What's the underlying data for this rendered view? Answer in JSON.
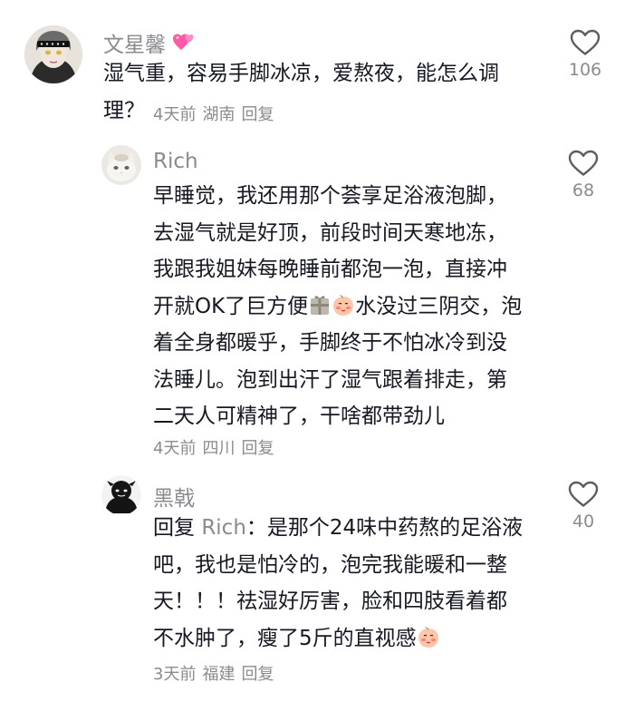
{
  "comments": [
    {
      "username": "文星馨",
      "username_emoji": "💕",
      "text": "湿气重，容易手脚冰凉，爱熬夜，能怎么调理？",
      "time": "4天前",
      "location": "湖南",
      "reply": "回复",
      "likes": "106"
    },
    {
      "username": "Rich",
      "text_lines": [
        "早睡觉，我还用那个荟享足浴液泡脚，",
        "去湿气就是好顶，前段时间天寒地冻，",
        "我跟我姐妹每晚睡前都泡一泡，直接冲",
        "开就OK了巨方便",
        "水没过三阴交，泡",
        "着全身都暖乎，手脚终于不怕冰冷到没",
        "法睡儿。泡到出汗了湿气跟着排走，第",
        "二天人可精神了，干啥都带劲儿"
      ],
      "time": "4天前",
      "location": "四川",
      "reply": "回复",
      "likes": "68"
    },
    {
      "username": "黑戟",
      "reply_prefix": "回复",
      "reply_to": "Rich",
      "reply_colon": "：是那个24味中药熬的足浴液",
      "text_lines": [
        "吧，我也是怕冷的，泡完我能暖和一整",
        "天！！！祛湿好厉害，脸和四肢看着都",
        "不水肿了，瘦了5斤的直视感"
      ],
      "time": "3天前",
      "location": "福建",
      "reply": "回复",
      "likes": "40"
    }
  ],
  "icons": {
    "like": "heart-outline-icon",
    "emoji_peach": "blush-emoji-icon",
    "emoji_gift": "gift-emoji-icon"
  },
  "colors": {
    "text": "#161823",
    "muted": "#8a8b91"
  }
}
